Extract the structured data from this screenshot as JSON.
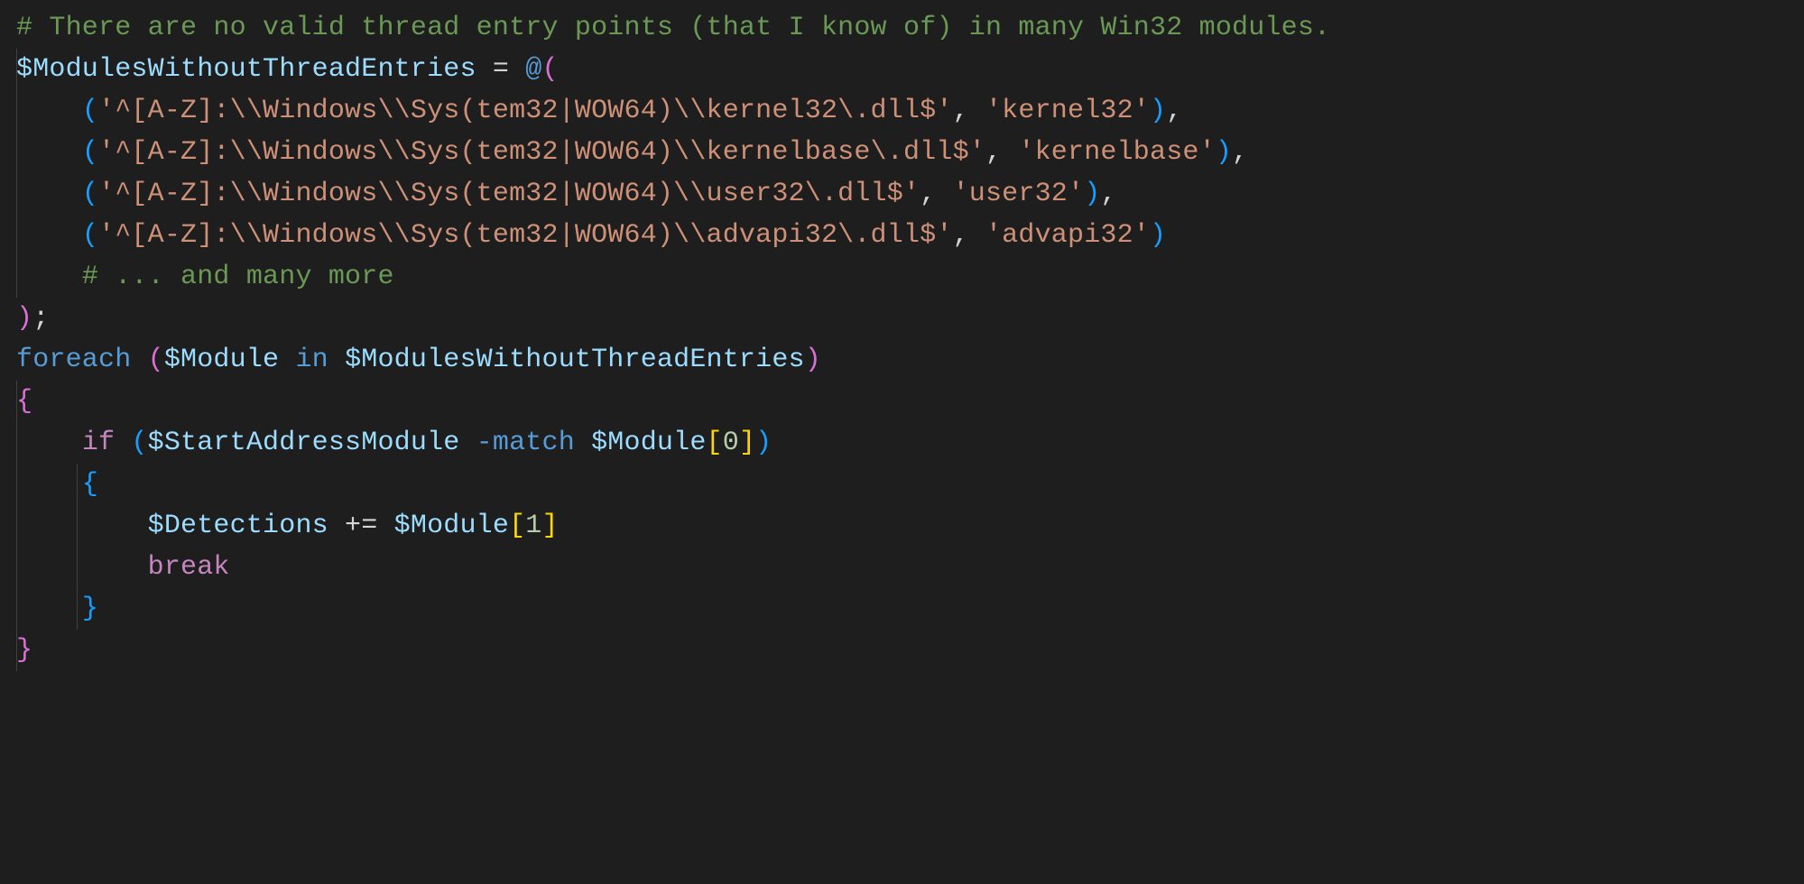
{
  "colors": {
    "background": "#1e1e1e",
    "comment": "#6a9955",
    "variable": "#9cdcfe",
    "keyword": "#569cd6",
    "control": "#c586c0",
    "string": "#ce9178",
    "number": "#b5cea8",
    "punct": "#d4d4d4",
    "bracket1": "#da70d6",
    "bracket2": "#179fff",
    "bracket3": "#ffd700"
  },
  "code": {
    "comment_top": "# There are no valid thread entry points (that I know of) in many Win32 modules.",
    "var_modules": "$ModulesWithoutThreadEntries",
    "op_assign": " = ",
    "at": "@",
    "entries": [
      {
        "regex": "'^[A-Z]:\\\\Windows\\\\Sys(tem32|WOW64)\\\\kernel32\\.dll$'",
        "name": "'kernel32'",
        "trailing_comma": ","
      },
      {
        "regex": "'^[A-Z]:\\\\Windows\\\\Sys(tem32|WOW64)\\\\kernelbase\\.dll$'",
        "name": "'kernelbase'",
        "trailing_comma": ","
      },
      {
        "regex": "'^[A-Z]:\\\\Windows\\\\Sys(tem32|WOW64)\\\\user32\\.dll$'",
        "name": "'user32'",
        "trailing_comma": ","
      },
      {
        "regex": "'^[A-Z]:\\\\Windows\\\\Sys(tem32|WOW64)\\\\advapi32\\.dll$'",
        "name": "'advapi32'",
        "trailing_comma": ""
      }
    ],
    "comment_more": "# ... and many more",
    "close_array": ");",
    "kw_foreach": "foreach",
    "var_module": "$Module",
    "kw_in": "in",
    "kw_if": "if",
    "var_startaddr": "$StartAddressModule",
    "op_match": "-match",
    "idx0": "0",
    "idx1": "1",
    "var_detections": "$Detections",
    "op_plus_eq": " += ",
    "kw_break": "break",
    "punct": {
      "lparen": "(",
      "rparen": ")",
      "lbrace": "{",
      "rbrace": "}",
      "lbracket": "[",
      "rbracket": "]",
      "comma_sp": ", "
    }
  }
}
